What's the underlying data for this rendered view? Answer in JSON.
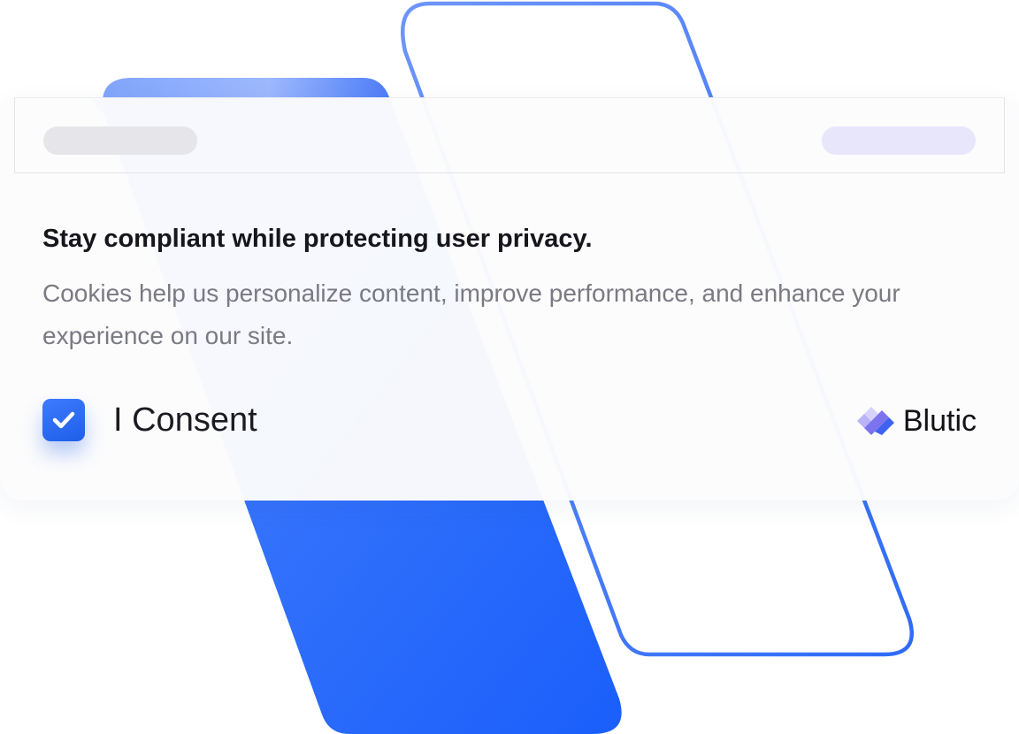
{
  "banner": {
    "headline": "Stay compliant while protecting user privacy.",
    "body": "Cookies help us personalize content, improve performance, and enhance your experience on our site.",
    "consent_label": "I Consent",
    "consent_checked": true,
    "brand_name": "Blutic"
  },
  "icons": {
    "checkbox": "checkmark-icon",
    "brand": "blutic-logo-icon"
  },
  "colors": {
    "accent": "#2563f5",
    "accent_light": "#8fb0ff",
    "headline": "#16161c",
    "body": "#7a7a82",
    "pill_left": "#e6e5ea",
    "pill_right": "#e8e6fb"
  }
}
